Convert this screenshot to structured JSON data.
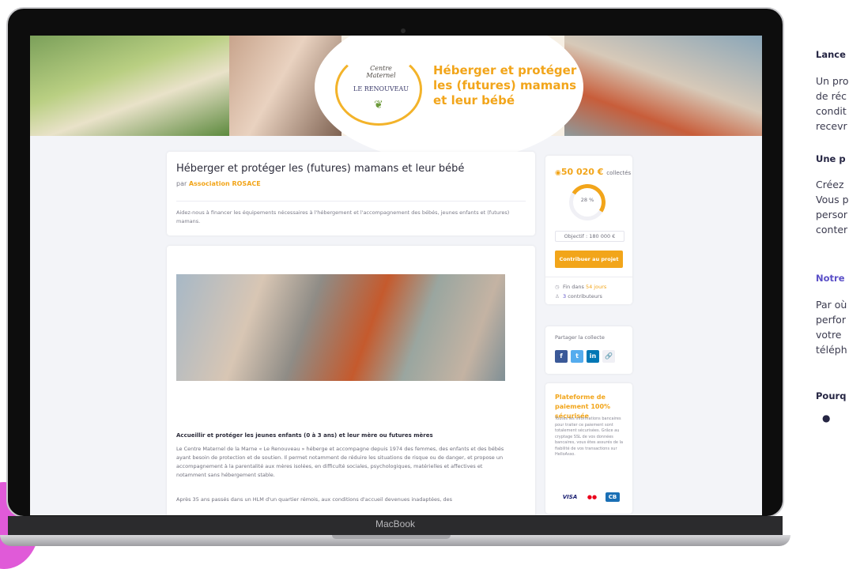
{
  "device": {
    "brand": "MacBook"
  },
  "site": {
    "logo": {
      "script": "Centre Maternel",
      "name": "LE RENOUVEAU"
    },
    "tagline": "Héberger et protéger les (futures) mamans et leur bébé"
  },
  "campaign": {
    "title": "Héberger et protéger les (futures) mamans et leur bébé",
    "by_prefix": "par",
    "organization": "Association ROSACE",
    "summary": "Aidez-nous à financer les équipements nécessaires à l'hébergement et l'accompagnement des bébés, jeunes enfants et (futures) mamans.",
    "section_title": "Accueillir et protéger les jeunes enfants (0 à 3 ans) et leur mère ou futures mères",
    "paragraph1": "Le Centre Maternel de la Marne « Le Renouveau » héberge et accompagne depuis 1974 des femmes, des enfants et des bébés ayant besoin de protection et de soutien. Il permet notamment de réduire les situations de risque ou de danger, et propose un accompagnement à la parentalité aux mères isolées, en difficulté sociales, psychologiques, matérielles et affectives et notamment sans hébergement stable.",
    "paragraph2": "Après 35 ans passés dans un HLM d'un quartier rémois, aux conditions d'accueil devenues inadaptées, des"
  },
  "funding": {
    "amount": "50 020 €",
    "amount_suffix": "collectés",
    "percent_label": "28 %",
    "percent": 28,
    "goal": "Objectif : 180 000 €",
    "cta": "Contribuer au projet",
    "ends_prefix": "Fin dans",
    "ends_value": "54 jours",
    "contributors_count": "3",
    "contributors_label": "contributeurs"
  },
  "share": {
    "label": "Partager la collecte",
    "buttons": [
      "f",
      "t",
      "in",
      "🔗"
    ]
  },
  "payment": {
    "title": "Plateforme de paiement 100% sécurisée",
    "text": "Toutes les informations bancaires pour traiter ce paiement sont totalement sécurisées. Grâce au cryptage SSL de vos données bancaires, vous êtes assurés de la fiabilité de vos transactions sur HelloAsso.",
    "cards": [
      "VISA",
      "●●",
      "CB"
    ]
  },
  "article": {
    "h1": "Lance",
    "p1": [
      "Un pro",
      "de réc",
      "condit",
      "recevr"
    ],
    "h2": "Une p",
    "p2": [
      "Créez",
      "Vous p",
      "persor",
      "conter"
    ],
    "h3": "Notre",
    "p3": [
      "Par où",
      "perfor",
      "votre",
      "téléph"
    ],
    "h4": "Pourq"
  },
  "colors": {
    "accent": "#f2a51a",
    "purple": "#5a4fc7"
  }
}
